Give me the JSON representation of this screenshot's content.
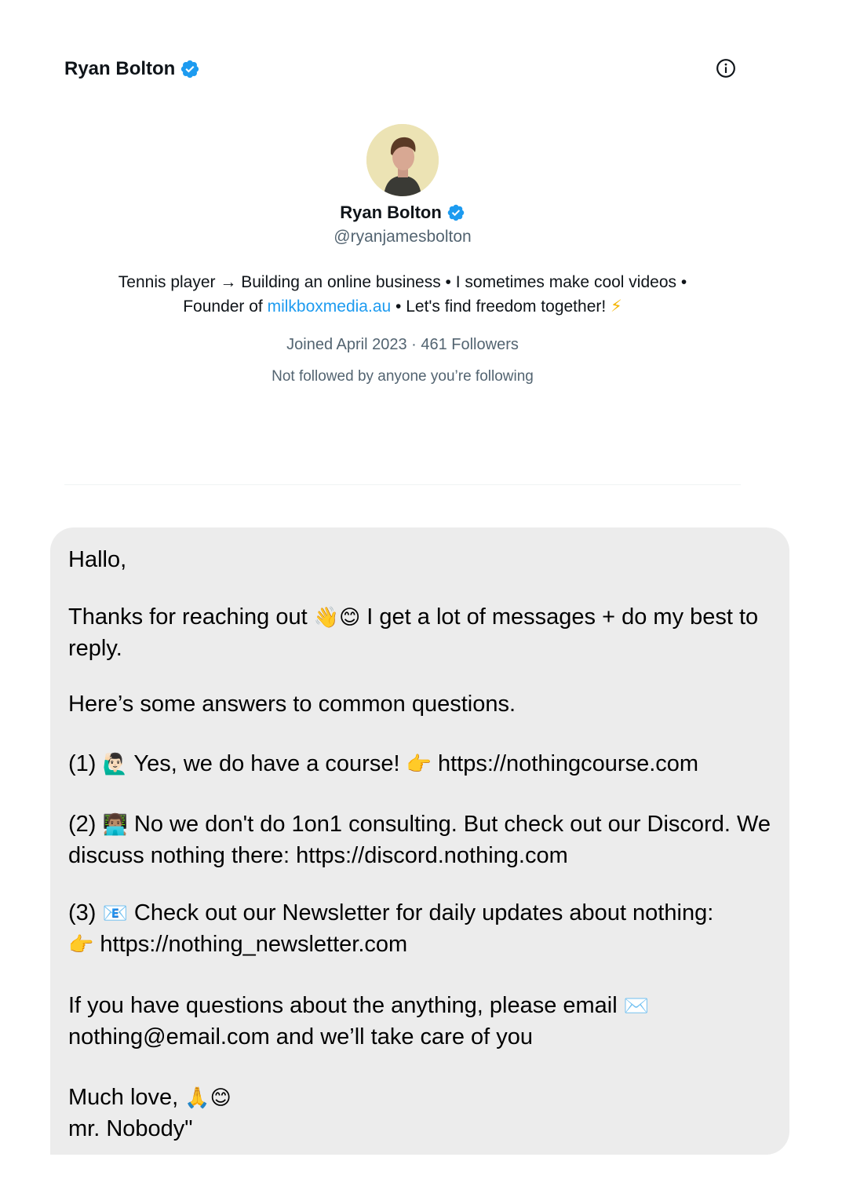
{
  "header": {
    "name": "Ryan Bolton",
    "verified_icon": "verified-badge-icon",
    "info_icon": "info-circle-icon"
  },
  "profile": {
    "name": "Ryan Bolton",
    "handle": "@ryanjamesbolton",
    "bio_line1": "Tennis player → Building an online business • I sometimes make cool videos •",
    "bio_line2_prefix": "Founder of ",
    "bio_link": "milkboxmedia.au",
    "bio_line2_suffix": " • Let's find freedom together! ",
    "bio_emoji": "⚡",
    "joined": "Joined April 2023 · 461 Followers",
    "followed_note": "Not followed by anyone you’re following"
  },
  "message": {
    "greeting": "Hallo,",
    "thanks_prefix": "Thanks for reaching out ",
    "thanks_emoji": "👋😊",
    "thanks_suffix": " I get a lot of messages + do my best to reply.",
    "intro": "Here’s some answers to common questions.",
    "q1_prefix": "(1) ",
    "q1_emoji": "🙋🏻‍♂️",
    "q1_text": " Yes, we do have a course! ",
    "q1_point": "👉",
    "q1_link": " https://nothingcourse.com",
    "q2_prefix": "(2) ",
    "q2_emoji": "👨🏽‍💻",
    "q2_text": " No we don't do 1on1 consulting. But check out our Discord. We discuss nothing there: https://discord.nothing.com",
    "q3_prefix": "(3) ",
    "q3_emoji": "📧",
    "q3_text": " Check out our Newsletter for daily updates about nothing:",
    "q3_point": "👉",
    "q3_link": " https://nothing_newsletter.com",
    "email_prefix": "If you have questions about the anything, please email ",
    "email_emoji": "✉️",
    "email_suffix": " nothing@email.com and we’ll take care of you",
    "signoff": "Much love, ",
    "signoff_emoji": "🙏😊",
    "signature": "mr. Nobody\""
  }
}
